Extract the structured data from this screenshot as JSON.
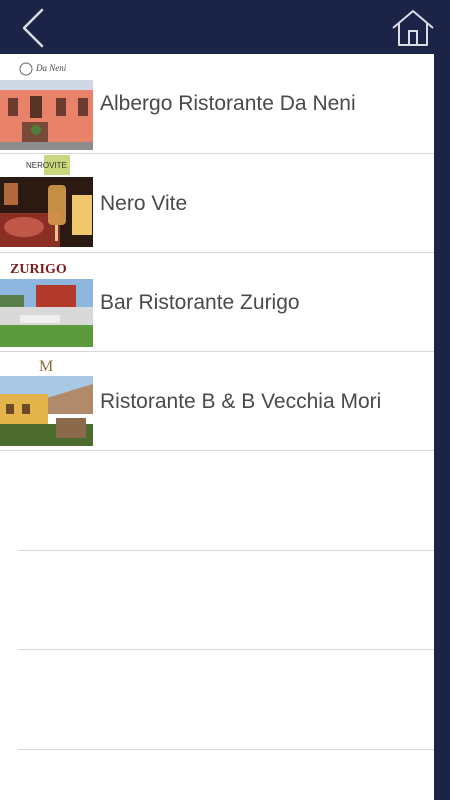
{
  "nav": {
    "back_icon": "chevron-left-icon",
    "home_icon": "home-icon",
    "bar_color": "#1b2347"
  },
  "restaurants": [
    {
      "name": "Albergo Ristorante Da Neni",
      "thumb_caption": "Da Neni"
    },
    {
      "name": "Nero Vite",
      "thumb_caption": "NEROVITE"
    },
    {
      "name": "Bar Ristorante Zurigo",
      "thumb_caption": "ZURIGO"
    },
    {
      "name": "Ristorante B & B Vecchia Mori",
      "thumb_caption": "M"
    }
  ]
}
